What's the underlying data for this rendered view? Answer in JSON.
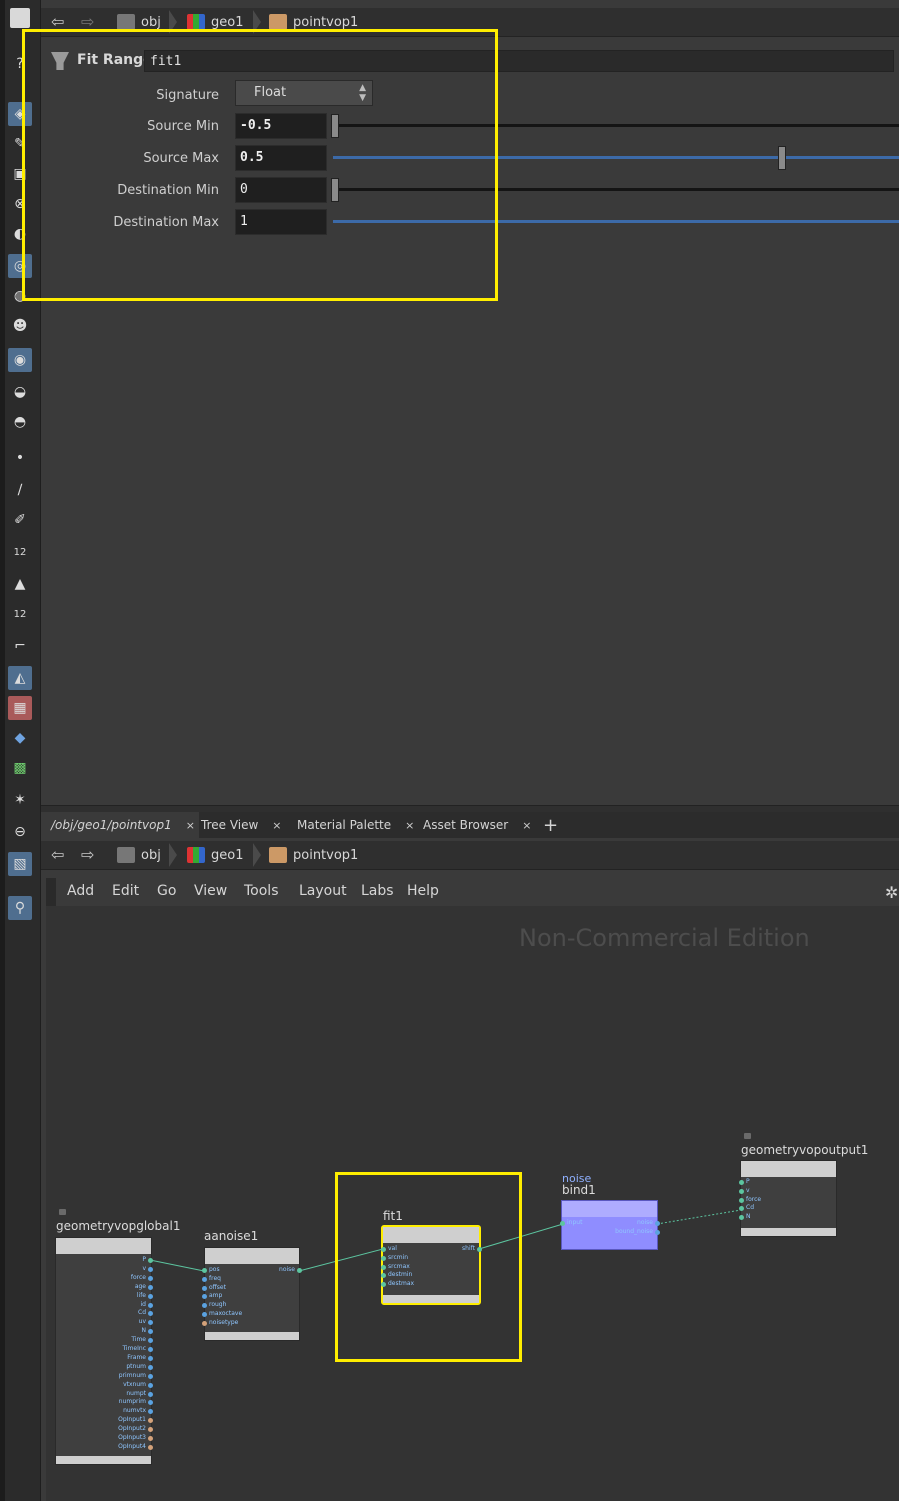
{
  "breadcrumb": {
    "items": [
      "obj",
      "geo1",
      "pointvop1"
    ]
  },
  "params": {
    "node_type": "Fit Range",
    "node_name": "fit1",
    "signature_label": "Signature",
    "signature_value": "Float",
    "rows": [
      {
        "label": "Source Min",
        "value": "-0.5"
      },
      {
        "label": "Source Max",
        "value": "0.5"
      },
      {
        "label": "Destination Min",
        "value": "0"
      },
      {
        "label": "Destination Max",
        "value": "1"
      }
    ]
  },
  "tabs": [
    {
      "label": "/obj/geo1/pointvop1",
      "close": "×"
    },
    {
      "label": "Tree View",
      "close": "×"
    },
    {
      "label": "Material Palette",
      "close": "×"
    },
    {
      "label": "Asset Browser",
      "close": "×"
    },
    {
      "label": "+"
    }
  ],
  "menu": [
    "Add",
    "Edit",
    "Go",
    "View",
    "Tools",
    "Layout",
    "Labs",
    "Help"
  ],
  "watermark": "Non-Commercial Edition",
  "nodes": {
    "global": {
      "name": "geometryvopglobal1",
      "outputs": [
        "P",
        "v",
        "force",
        "age",
        "life",
        "id",
        "Cd",
        "uv",
        "N",
        "Time",
        "TimeInc",
        "Frame",
        "ptnum",
        "primnum",
        "vtxnum",
        "numpt",
        "numprim",
        "numvtx",
        "OpInput1",
        "OpInput2",
        "OpInput3",
        "OpInput4"
      ]
    },
    "aanoise": {
      "name": "aanoise1",
      "inputs": [
        "pos",
        "freq",
        "offset",
        "amp",
        "rough",
        "maxoctave",
        "noisetype"
      ],
      "output": "noise"
    },
    "fit": {
      "name": "fit1",
      "inputs": [
        "val",
        "srcmin",
        "srcmax",
        "destmin",
        "destmax"
      ],
      "output": "shift"
    },
    "bind": {
      "label": "noise",
      "name": "bind1",
      "input": "input",
      "outputs": [
        "noise",
        "bound_noise"
      ]
    },
    "output": {
      "name": "geometryvopoutput1",
      "inputs": [
        "P",
        "v",
        "force",
        "Cd",
        "N"
      ]
    }
  },
  "colors": {
    "highlight": "#ffee00",
    "bind_node": "#8f8dff",
    "wire": "#5cc5a0"
  }
}
